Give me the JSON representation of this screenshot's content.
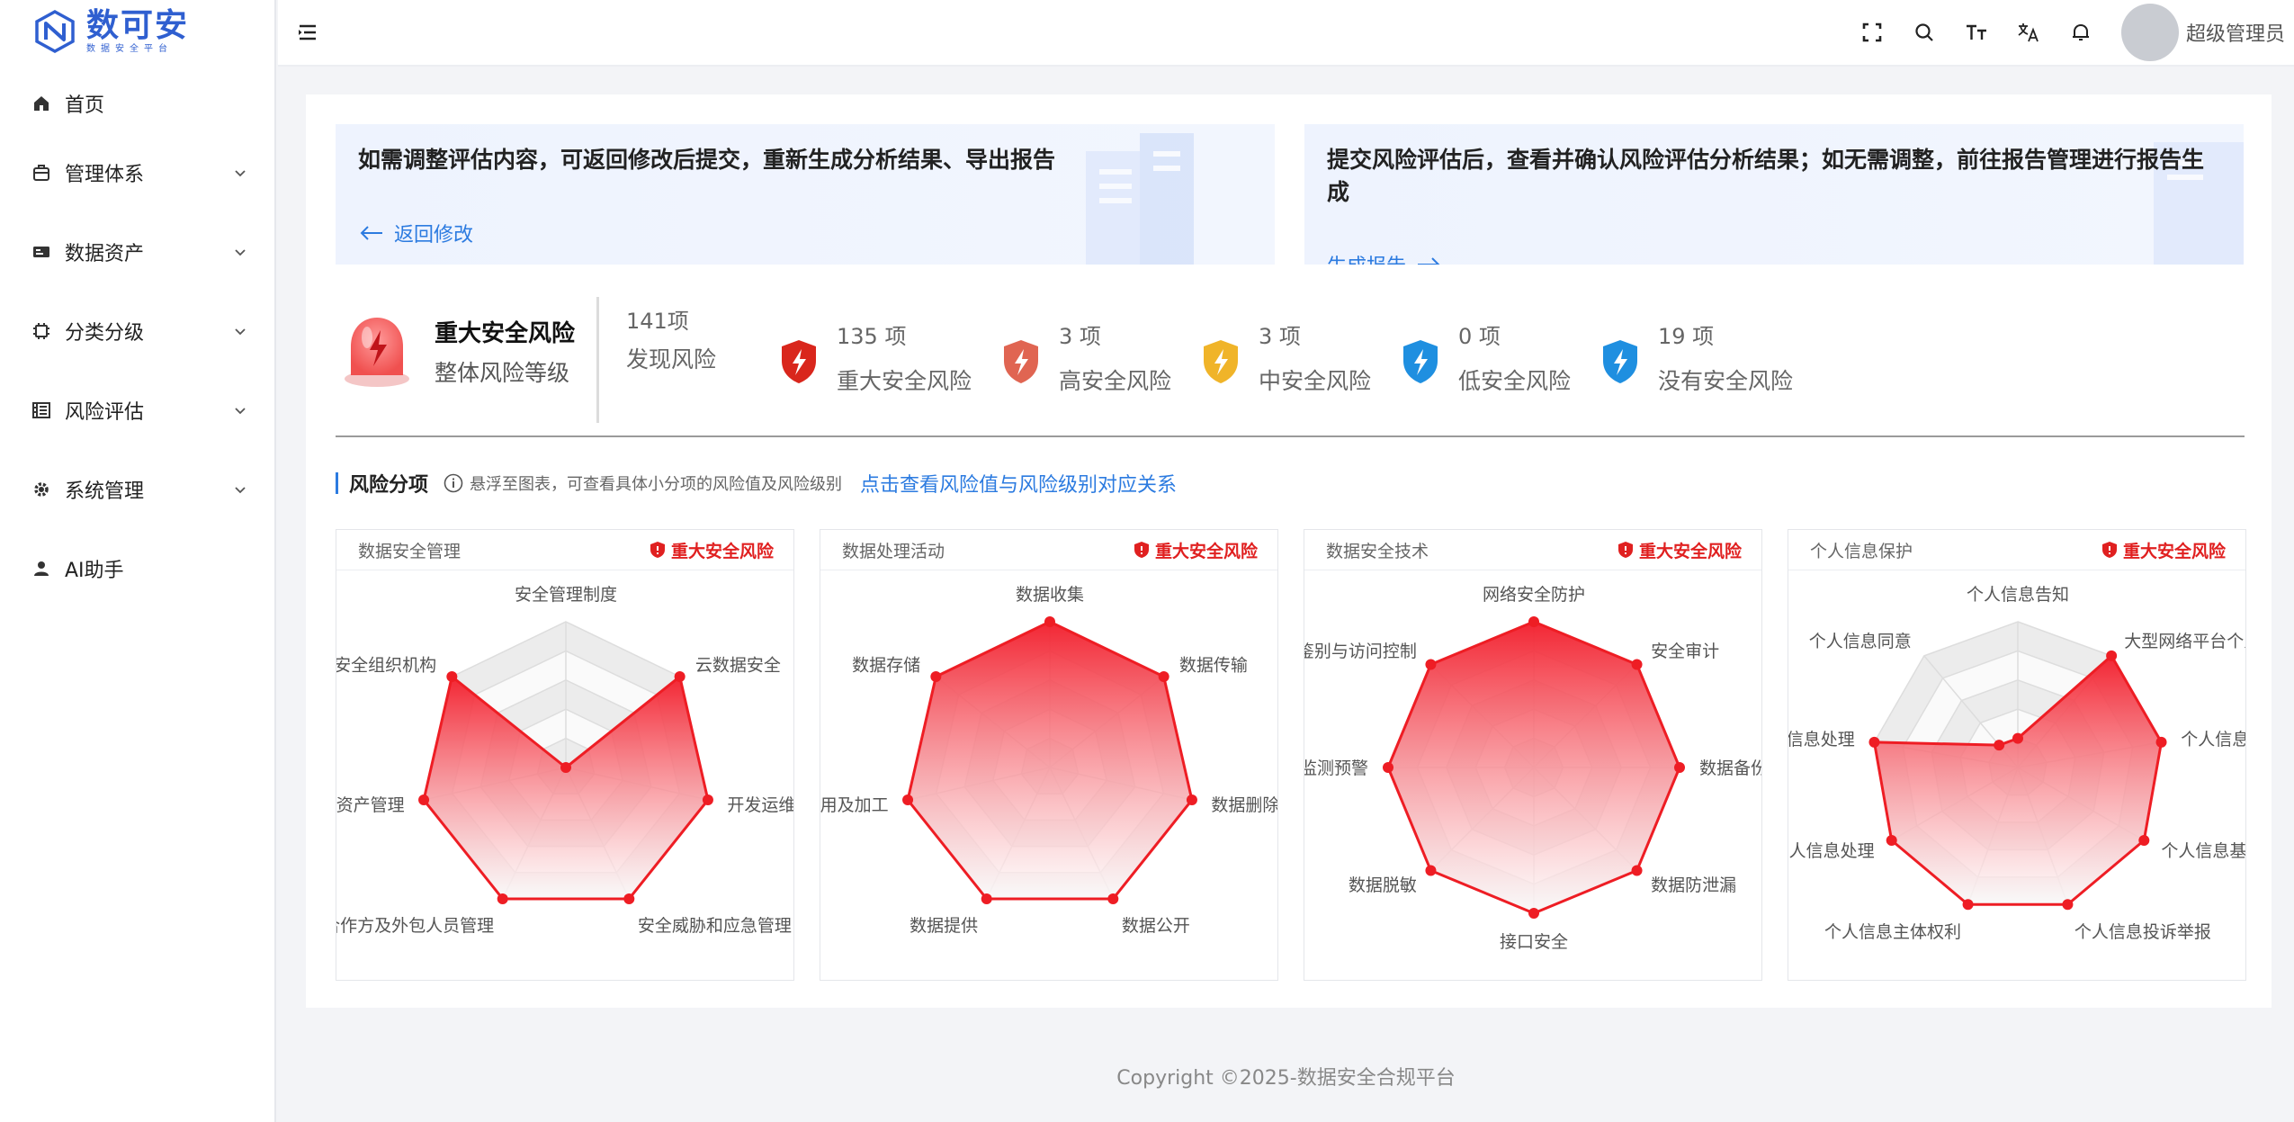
{
  "app": {
    "logo_title": "数可安",
    "logo_sub": "数据安全平台"
  },
  "sidebar": {
    "items": [
      {
        "label": "首页",
        "icon": "home-icon",
        "expandable": false
      },
      {
        "label": "管理体系",
        "icon": "briefcase-icon",
        "expandable": true
      },
      {
        "label": "数据资产",
        "icon": "id-card-icon",
        "expandable": true
      },
      {
        "label": "分类分级",
        "icon": "chip-icon",
        "expandable": true
      },
      {
        "label": "风险评估",
        "icon": "calculator-icon",
        "expandable": true
      },
      {
        "label": "系统管理",
        "icon": "gear-icon",
        "expandable": true
      },
      {
        "label": "AI助手",
        "icon": "user-icon",
        "expandable": false
      }
    ]
  },
  "header": {
    "tools": [
      "fullscreen-icon",
      "search-icon",
      "font-size-icon",
      "translate-icon",
      "bell-icon"
    ],
    "username": "超级管理员"
  },
  "banners": [
    {
      "text": "如需调整评估内容，可返回修改后提交，重新生成分析结果、导出报告",
      "link": "返回修改"
    },
    {
      "text": "提交风险评估后，查看并确认风险评估分析结果；如无需调整，前往报告管理进行报告生成",
      "link": "生成报告"
    }
  ],
  "summary": {
    "level_title": "重大安全风险",
    "level_sub": "整体风险等级",
    "found_count": "141项",
    "found_label": "发现风险",
    "stats": [
      {
        "count": "135 项",
        "label": "重大安全风险",
        "color": "#d9261c"
      },
      {
        "count": "3 项",
        "label": "高安全风险",
        "color": "#e06552"
      },
      {
        "count": "3 项",
        "label": "中安全风险",
        "color": "#f0b429"
      },
      {
        "count": "0 项",
        "label": "低安全风险",
        "color": "#1f8fe0"
      },
      {
        "count": "19 项",
        "label": "没有安全风险",
        "color": "#1f8fe0"
      }
    ]
  },
  "section": {
    "title": "风险分项",
    "hint": "悬浮至图表，可查看具体小分项的风险值及风险级别",
    "link": "点击查看风险值与风险级别对应关系"
  },
  "chart_data": [
    {
      "type": "radar",
      "title": "数据安全管理",
      "level": "重大安全风险",
      "axes": [
        "安全管理制度",
        "云数据安全",
        "开发运维",
        "安全威胁和应急管理",
        "合作方及外包人员管理",
        "资产管理",
        "安全组织机构"
      ],
      "values": [
        0,
        1,
        1,
        1,
        1,
        1,
        1
      ],
      "max": 1
    },
    {
      "type": "radar",
      "title": "数据处理活动",
      "level": "重大安全风险",
      "axes": [
        "数据收集",
        "数据传输",
        "数据删除",
        "数据公开",
        "数据提供",
        "数据使用及加工",
        "数据存储"
      ],
      "values": [
        1,
        1,
        1,
        1,
        1,
        1,
        1
      ],
      "max": 1
    },
    {
      "type": "radar",
      "title": "数据安全技术",
      "level": "重大安全风险",
      "axes": [
        "网络安全防护",
        "安全审计",
        "数据备份",
        "数据防泄漏",
        "接口安全",
        "数据脱敏",
        "监测预警",
        "身份鉴别与访问控制"
      ],
      "values": [
        1,
        1,
        1,
        1,
        1,
        1,
        1,
        1
      ],
      "max": 1
    },
    {
      "type": "radar",
      "title": "个人信息保护",
      "level": "重大安全风险",
      "axes": [
        "个人信息告知",
        "大型网络平台个人信息保护",
        "个人信息",
        "个人信息基",
        "个人信息投诉举报",
        "个人信息主体权利",
        "个人信息处理",
        "信息处理",
        "个人信息同意"
      ],
      "values": [
        0.2,
        1,
        1,
        1,
        1,
        1,
        1,
        1,
        0.2
      ],
      "max": 1
    }
  ],
  "footer": {
    "text": "Copyright ©2025-数据安全合规平台"
  }
}
